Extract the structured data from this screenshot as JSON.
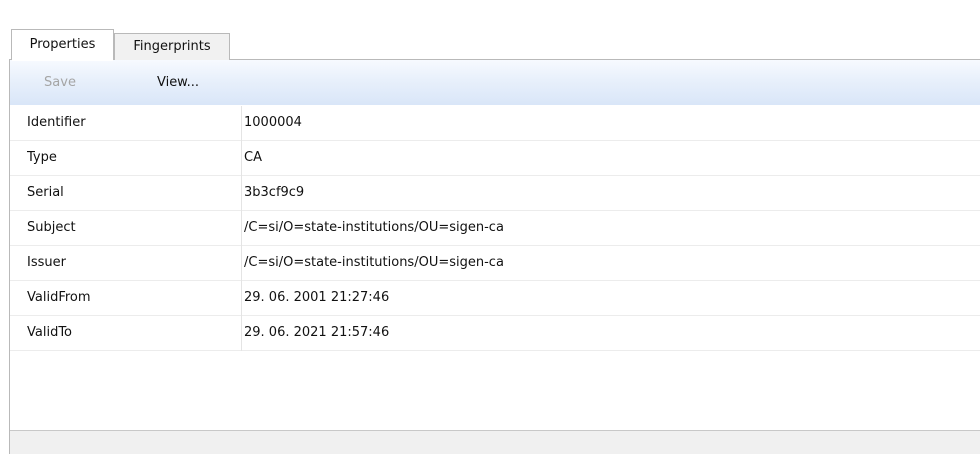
{
  "tabs": [
    {
      "label": "Properties",
      "active": true
    },
    {
      "label": "Fingerprints",
      "active": false
    }
  ],
  "toolbar": {
    "save_label": "Save",
    "save_enabled": false,
    "view_label": "View..."
  },
  "properties": {
    "rows": [
      {
        "name": "Identifier",
        "value": "1000004"
      },
      {
        "name": "Type",
        "value": "CA"
      },
      {
        "name": "Serial",
        "value": "3b3cf9c9"
      },
      {
        "name": "Subject",
        "value": "/C=si/O=state-institutions/OU=sigen-ca"
      },
      {
        "name": "Issuer",
        "value": "/C=si/O=state-institutions/OU=sigen-ca"
      },
      {
        "name": "ValidFrom",
        "value": "29. 06. 2001 21:27:46"
      },
      {
        "name": "ValidTo",
        "value": "29. 06. 2021 21:57:46"
      }
    ]
  },
  "colors": {
    "toolbar_gradient_top": "#f7faff",
    "toolbar_gradient_bottom": "#d9e6f8",
    "border": "#b9b9b9",
    "disabled_text": "#a5a5a5",
    "row_separator": "#ececec",
    "statusbar": "#f0f0f0"
  }
}
